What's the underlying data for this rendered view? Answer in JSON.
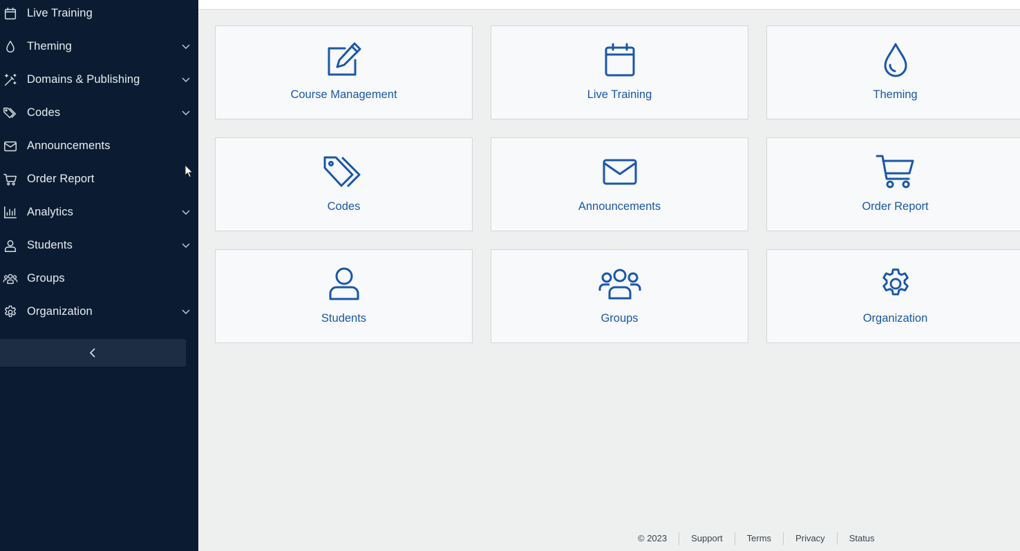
{
  "sidebar": {
    "items": [
      {
        "label": "Live Training",
        "icon": "calendar-icon",
        "has_chevron": false
      },
      {
        "label": "Theming",
        "icon": "droplet-icon",
        "has_chevron": true
      },
      {
        "label": "Domains & Publishing",
        "icon": "magic-wand-icon",
        "has_chevron": true
      },
      {
        "label": "Codes",
        "icon": "tags-icon",
        "has_chevron": true
      },
      {
        "label": "Announcements",
        "icon": "envelope-icon",
        "has_chevron": false
      },
      {
        "label": "Order Report",
        "icon": "cart-icon",
        "has_chevron": false
      },
      {
        "label": "Analytics",
        "icon": "bar-chart-icon",
        "has_chevron": true
      },
      {
        "label": "Students",
        "icon": "user-icon",
        "has_chevron": true
      },
      {
        "label": "Groups",
        "icon": "users-icon",
        "has_chevron": false
      },
      {
        "label": "Organization",
        "icon": "gear-icon",
        "has_chevron": true
      }
    ],
    "collapse_icon": "chevron-left-icon"
  },
  "tiles": [
    {
      "label": "Course Management",
      "icon": "edit-icon"
    },
    {
      "label": "Live Training",
      "icon": "calendar-icon"
    },
    {
      "label": "Theming",
      "icon": "droplet-icon"
    },
    {
      "label": "Codes",
      "icon": "tags-icon"
    },
    {
      "label": "Announcements",
      "icon": "envelope-icon"
    },
    {
      "label": "Order Report",
      "icon": "cart-icon"
    },
    {
      "label": "Students",
      "icon": "user-icon"
    },
    {
      "label": "Groups",
      "icon": "users-icon"
    },
    {
      "label": "Organization",
      "icon": "gear-icon"
    }
  ],
  "footer": {
    "copyright": "© 2023",
    "support": "Support",
    "terms": "Terms",
    "privacy": "Privacy",
    "status": "Status"
  },
  "colors": {
    "sidebar_bg": "#0b1c32",
    "accent": "#1a56a8",
    "tile_bg": "#f7f9fb",
    "page_bg": "#eef0f0"
  }
}
